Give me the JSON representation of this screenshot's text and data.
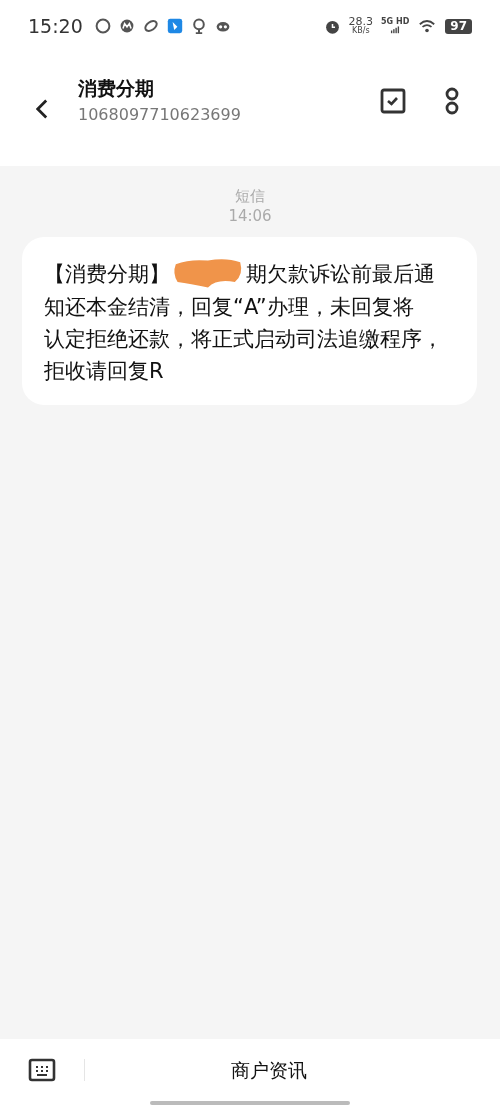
{
  "status_bar": {
    "time": "15:20",
    "speed": "28.3",
    "speed_unit": "KB/s",
    "network": "5G HD",
    "battery": "97"
  },
  "header": {
    "title": "消费分期",
    "number": "1068097710623699"
  },
  "conversation": {
    "channel": "短信",
    "time": "14:06",
    "message": {
      "prefix": "【消费分期】",
      "lines": [
        "期欠款诉讼前最后通",
        "知还本金结清，回复“A”办理，未回复将",
        "认定拒绝还款，将正式启动司法追缴程序，",
        "拒收请回复R"
      ]
    }
  },
  "bottom_bar": {
    "menu_label": "商户资讯"
  }
}
